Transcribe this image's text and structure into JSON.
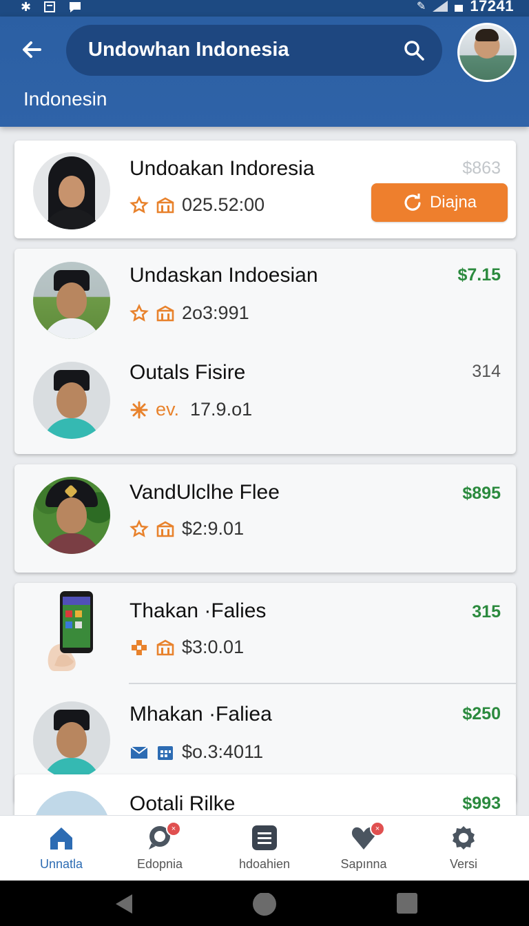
{
  "status_bar": {
    "time": "17241",
    "left_icons": [
      "bluetooth-icon",
      "notification-icon",
      "chat-icon"
    ],
    "right_icons": [
      "mute-icon",
      "signal-icon",
      "battery-icon"
    ]
  },
  "header": {
    "search_title": "Undowhan Indonesia",
    "subtitle": "Indonesin"
  },
  "list": [
    {
      "card": 1,
      "rows": [
        {
          "name": "Undoakan Indoresia",
          "meta_value": "025.52:00",
          "price": "$863",
          "action_label": "Diajna"
        }
      ]
    },
    {
      "card": 2,
      "rows": [
        {
          "name": "Undaskan Indoesian",
          "meta_value": "2o3:991",
          "price": "$7.15"
        },
        {
          "name": "Outals Fisire",
          "meta_prefix": "ev.",
          "meta_value": "17.9.o1",
          "price": "314"
        }
      ]
    },
    {
      "card": 3,
      "rows": [
        {
          "name": "VandUlclhe Flee",
          "meta_value": "$2:9.01",
          "price": "$895"
        }
      ]
    },
    {
      "card": 4,
      "rows": [
        {
          "name": "Thakan ·Falies",
          "meta_value": "$3:0.01",
          "price": "315"
        },
        {
          "name": "Mhakan ·Faliea",
          "meta_value": "$o.3:4011",
          "price": "$250"
        }
      ]
    },
    {
      "card": 5,
      "rows": [
        {
          "name": "Ootali Rilke",
          "price": "$993"
        }
      ]
    }
  ],
  "bottom_nav": [
    {
      "label": "Unnatla",
      "icon": "home-icon",
      "active": true
    },
    {
      "label": "Edopnia",
      "icon": "chat-bubble-icon",
      "badge": "×"
    },
    {
      "label": "hdoahien",
      "icon": "list-icon"
    },
    {
      "label": "Sapınna",
      "icon": "heart-icon",
      "badge": "×"
    },
    {
      "label": "Versi",
      "icon": "settings-icon"
    }
  ],
  "colors": {
    "header_blue": "#2f63a8",
    "search_pill": "#1e4780",
    "accent_orange": "#ee7f2d",
    "price_green": "#2b8a3e",
    "nav_active": "#2d6cb3"
  }
}
